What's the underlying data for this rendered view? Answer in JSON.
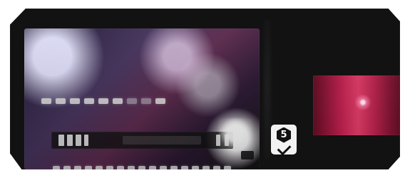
{
  "window": {
    "title": ""
  },
  "main": {
    "preview": {
      "description": ""
    },
    "badge": {
      "label": "5"
    },
    "thumbnail": {
      "description": ""
    }
  }
}
